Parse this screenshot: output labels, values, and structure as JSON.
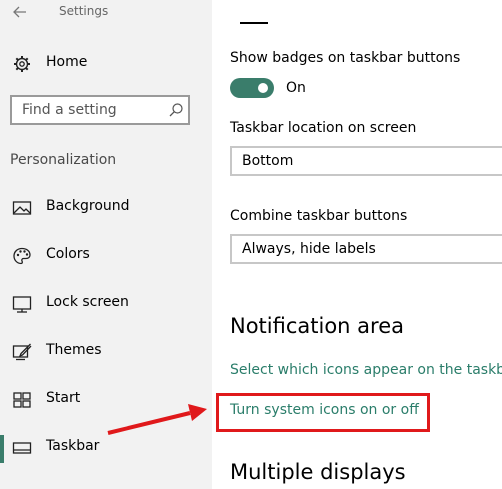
{
  "window": {
    "title": "Settings"
  },
  "sidebar": {
    "home_label": "Home",
    "search_placeholder": "Find a setting",
    "section_header": "Personalization",
    "items": [
      {
        "label": "Background",
        "icon": "picture-icon"
      },
      {
        "label": "Colors",
        "icon": "palette-icon"
      },
      {
        "label": "Lock screen",
        "icon": "lock-screen-icon"
      },
      {
        "label": "Themes",
        "icon": "brush-icon"
      },
      {
        "label": "Start",
        "icon": "start-grid-icon"
      },
      {
        "label": "Taskbar",
        "icon": "taskbar-icon",
        "selected": true
      }
    ]
  },
  "main": {
    "badges_label": "Show badges on taskbar buttons",
    "badges_toggle_state": "On",
    "badges_toggle_on": true,
    "location_label": "Taskbar location on screen",
    "location_value": "Bottom",
    "combine_label": "Combine taskbar buttons",
    "combine_value": "Always, hide labels",
    "notification_title": "Notification area",
    "link_select_icons": "Select which icons appear on the taskbar",
    "link_system_icons": "Turn system icons on or off",
    "multiple_displays_title": "Multiple displays"
  },
  "colors": {
    "accent": "#3a7d6b",
    "link": "#2a7d6a",
    "annotation": "#e0191b",
    "sidebar_bg": "#f2f2f2"
  }
}
